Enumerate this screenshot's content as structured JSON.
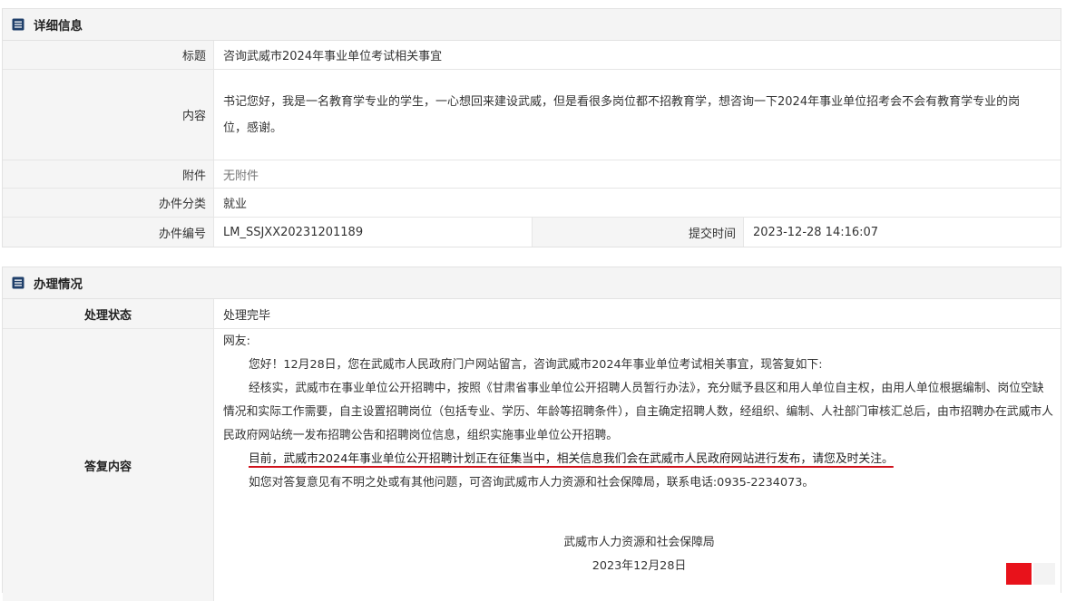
{
  "detail": {
    "header": "详细信息",
    "title_label": "标题",
    "title_value": "咨询武威市2024年事业单位考试相关事宜",
    "content_label": "内容",
    "content_value": "书记您好，我是一名教育学专业的学生，一心想回来建设武威，但是看很多岗位都不招教育学，想咨询一下2024年事业单位招考会不会有教育学专业的岗位，感谢。",
    "attachment_label": "附件",
    "attachment_value": "无附件",
    "category_label": "办件分类",
    "category_value": "就业",
    "number_label": "办件编号",
    "number_value": "LM_SSJXX20231201189",
    "time_label": "提交时间",
    "time_value": "2023-12-28 14:16:07"
  },
  "handling": {
    "header": "办理情况",
    "status_label": "处理状态",
    "status_value": "处理完毕",
    "reply_label": "答复内容",
    "reply": {
      "greeting": "网友:",
      "p1": "您好！12月28日，您在武威市人民政府门户网站留言，咨询武威市2024年事业单位考试相关事宜，现答复如下:",
      "p2": "经核实，武威市在事业单位公开招聘中，按照《甘肃省事业单位公开招聘人员暂行办法》，充分赋予县区和用人单位自主权，由用人单位根据编制、岗位空缺情况和实际工作需要，自主设置招聘岗位（包括专业、学历、年龄等招聘条件），自主确定招聘人数，经组织、编制、人社部门审核汇总后，由市招聘办在武威市人民政府网站统一发布招聘公告和招聘岗位信息，组织实施事业单位公开招聘。",
      "p3": "目前，武威市2024年事业单位公开招聘计划正在征集当中，相关信息我们会在武威市人民政府网站进行发布，请您及时关注。",
      "p4": "如您对答复意见有不明之处或有其他问题，可咨询武威市人力资源和社会保障局，联系电话:0935-2234073。",
      "signature": "武威市人力资源和社会保障局",
      "date": "2023年12月28日"
    }
  },
  "colors": {
    "underline": "#d0111b",
    "header_bg": "#f4f4f4",
    "label_bg": "#f5f5f5"
  },
  "icons": {
    "detail_header_icon": "list-doc-icon",
    "handling_header_icon": "list-doc-icon"
  }
}
